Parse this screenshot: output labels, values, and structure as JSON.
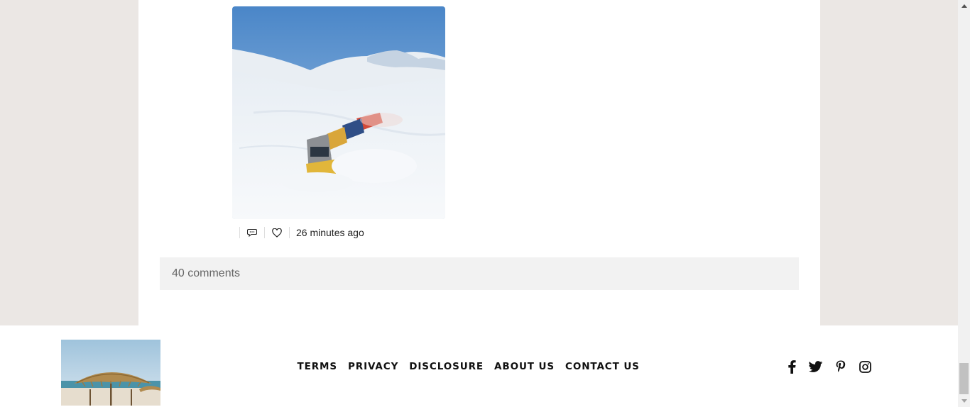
{
  "post": {
    "image_alt": "Train plowing through deep snow in a mountain landscape",
    "actions": {
      "comment_icon": "speech-bubble-icon",
      "like_icon": "heart-icon"
    },
    "timestamp": "26 minutes ago"
  },
  "comments": {
    "label": "40 comments"
  },
  "footer": {
    "logo_alt": "Beach umbrella logo",
    "nav": [
      "TERMS",
      "PRIVACY",
      "DISCLOSURE",
      "ABOUT US",
      "CONTACT US"
    ],
    "social": [
      "facebook-icon",
      "twitter-icon",
      "pinterest-icon",
      "instagram-icon"
    ]
  },
  "colors": {
    "page_background": "#ebe7e4",
    "content_background": "#ffffff",
    "comments_bar": "#f2f2f2",
    "text": "#222222"
  }
}
